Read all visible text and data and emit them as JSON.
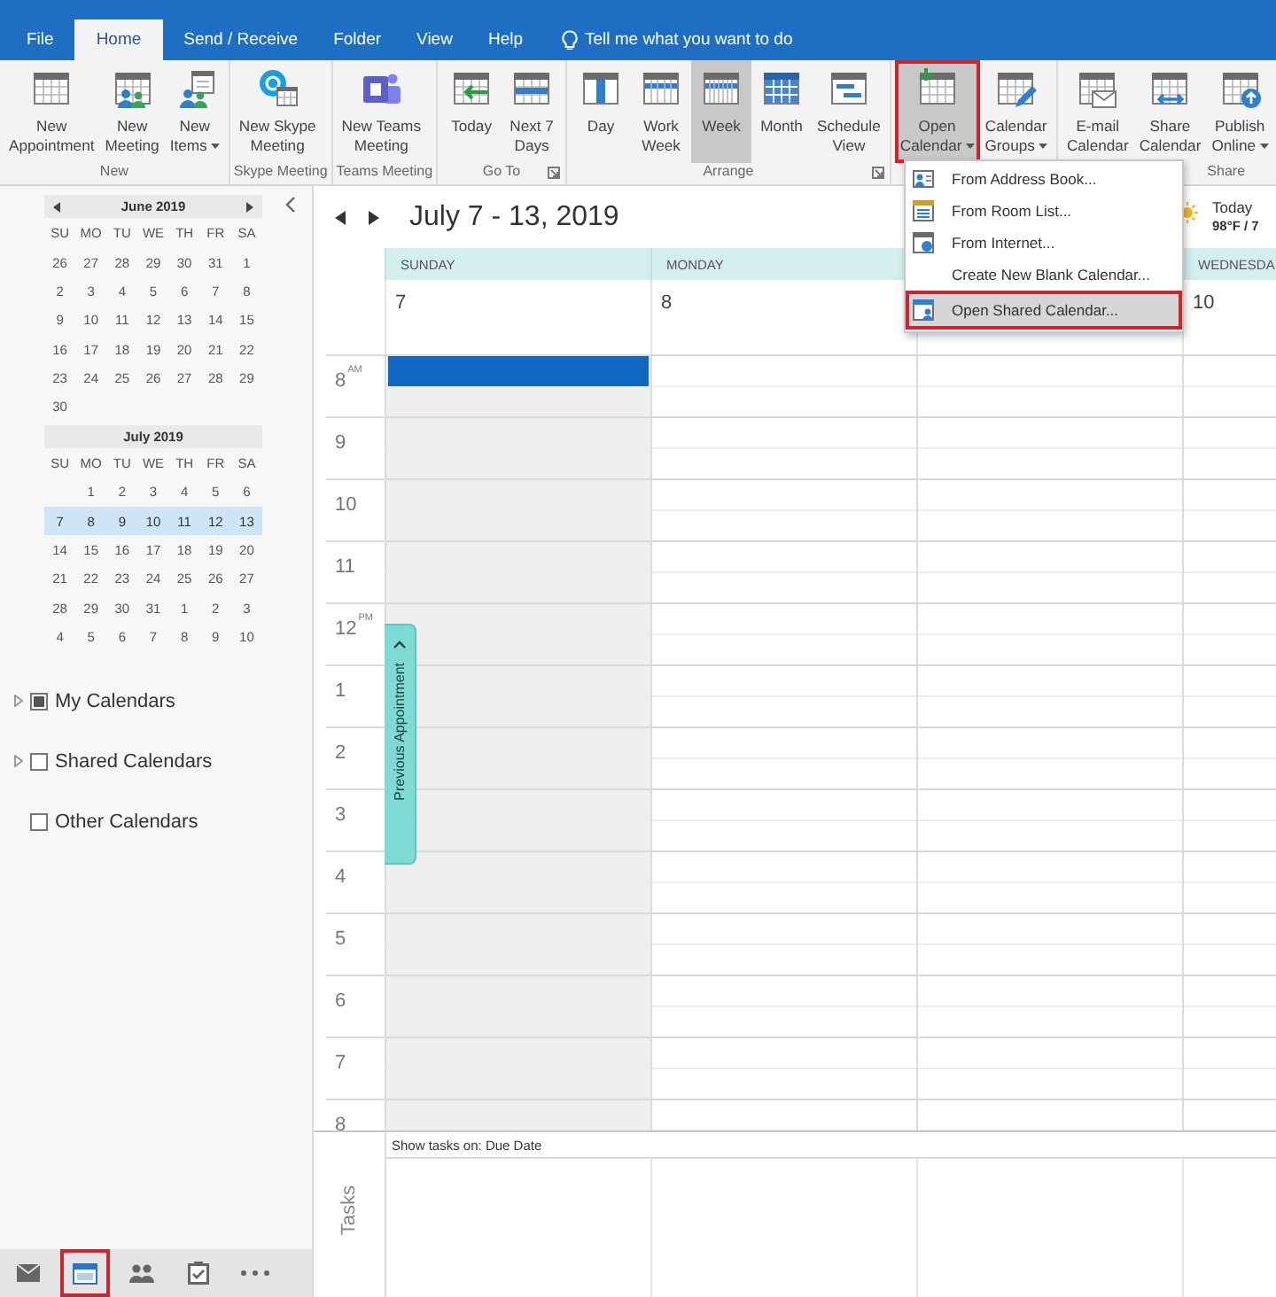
{
  "ribbon_tabs": [
    {
      "label": "File",
      "selected": false
    },
    {
      "label": "Home",
      "selected": true
    },
    {
      "label": "Send / Receive",
      "selected": false
    },
    {
      "label": "Folder",
      "selected": false
    },
    {
      "label": "View",
      "selected": false
    },
    {
      "label": "Help",
      "selected": false
    }
  ],
  "tell_me": {
    "placeholder": "Tell me what you want to do"
  },
  "ribbon_groups": [
    {
      "label": "New",
      "launcher": false,
      "buttons": [
        {
          "label": "New\nAppointment",
          "dropdown": false,
          "selected": false,
          "highlighted": false
        },
        {
          "label": "New\nMeeting",
          "dropdown": false,
          "selected": false,
          "highlighted": false
        },
        {
          "label": "New\nItems",
          "dropdown": true,
          "selected": false,
          "highlighted": false
        }
      ]
    },
    {
      "label": "Skype Meeting",
      "launcher": false,
      "buttons": [
        {
          "label": "New Skype\nMeeting",
          "dropdown": false,
          "selected": false,
          "highlighted": false
        }
      ]
    },
    {
      "label": "Teams Meeting",
      "launcher": false,
      "buttons": [
        {
          "label": "New Teams\nMeeting",
          "dropdown": false,
          "selected": false,
          "highlighted": false
        }
      ]
    },
    {
      "label": "Go To",
      "launcher": true,
      "buttons": [
        {
          "label": "Today",
          "dropdown": false,
          "selected": false,
          "highlighted": false
        },
        {
          "label": "Next 7\nDays",
          "dropdown": false,
          "selected": false,
          "highlighted": false
        }
      ]
    },
    {
      "label": "Arrange",
      "launcher": true,
      "buttons": [
        {
          "label": "Day",
          "dropdown": false,
          "selected": false,
          "highlighted": false
        },
        {
          "label": "Work\nWeek",
          "dropdown": false,
          "selected": false,
          "highlighted": false
        },
        {
          "label": "Week",
          "dropdown": false,
          "selected": true,
          "highlighted": false
        },
        {
          "label": "Month",
          "dropdown": false,
          "selected": false,
          "highlighted": false
        },
        {
          "label": "Schedule\nView",
          "dropdown": false,
          "selected": false,
          "highlighted": false
        }
      ]
    },
    {
      "buttons": [
        {
          "label": "Open\nCalendar",
          "dropdown": true,
          "selected": true,
          "highlighted": true
        },
        {
          "label": "Calendar\nGroups",
          "dropdown": true,
          "selected": false,
          "highlighted": false
        }
      ]
    },
    {
      "label": "Share",
      "launcher": false,
      "buttons": [
        {
          "label": "E-mail\nCalendar",
          "dropdown": false,
          "selected": false,
          "highlighted": false
        },
        {
          "label": "Share\nCalendar",
          "dropdown": false,
          "selected": false,
          "highlighted": false
        },
        {
          "label": "Publish\nOnline",
          "dropdown": true,
          "selected": false,
          "highlighted": false
        }
      ]
    }
  ],
  "open_calendar_menu": {
    "items": [
      {
        "label": "From Address Book...",
        "selected": false,
        "highlighted": false
      },
      {
        "label": "From Room List...",
        "selected": false,
        "highlighted": false
      },
      {
        "label": "From Internet...",
        "selected": false,
        "highlighted": false
      },
      {
        "label": "Create New Blank Calendar...",
        "selected": false,
        "highlighted": false
      },
      {
        "label": "Open Shared Calendar...",
        "selected": true,
        "highlighted": true
      }
    ]
  },
  "date_navigator": {
    "months": [
      {
        "title": "June 2019",
        "arrows": true,
        "weekdays": [
          "SU",
          "MO",
          "TU",
          "WE",
          "TH",
          "FR",
          "SA"
        ],
        "weeks": [
          {
            "days": [
              "26",
              "27",
              "28",
              "29",
              "30",
              "31",
              "1"
            ],
            "selected": false
          },
          {
            "days": [
              "2",
              "3",
              "4",
              "5",
              "6",
              "7",
              "8"
            ],
            "selected": false
          },
          {
            "days": [
              "9",
              "10",
              "11",
              "12",
              "13",
              "14",
              "15"
            ],
            "selected": false
          },
          {
            "days": [
              "16",
              "17",
              "18",
              "19",
              "20",
              "21",
              "22"
            ],
            "selected": false
          },
          {
            "days": [
              "23",
              "24",
              "25",
              "26",
              "27",
              "28",
              "29"
            ],
            "selected": false
          },
          {
            "days": [
              "30"
            ],
            "selected": false
          }
        ]
      },
      {
        "title": "July 2019",
        "arrows": false,
        "weekdays": [
          "SU",
          "MO",
          "TU",
          "WE",
          "TH",
          "FR",
          "SA"
        ],
        "weeks": [
          {
            "days": [
              "1",
              "2",
              "3",
              "4",
              "5",
              "6"
            ],
            "selected": false
          },
          {
            "days": [
              "7",
              "8",
              "9",
              "10",
              "11",
              "12",
              "13"
            ],
            "selected": true
          },
          {
            "days": [
              "14",
              "15",
              "16",
              "17",
              "18",
              "19",
              "20"
            ],
            "selected": false
          },
          {
            "days": [
              "21",
              "22",
              "23",
              "24",
              "25",
              "26",
              "27"
            ],
            "selected": false
          },
          {
            "days": [
              "28",
              "29",
              "30",
              "31",
              "1",
              "2",
              "3"
            ],
            "selected": false
          },
          {
            "days": [
              "4",
              "5",
              "6",
              "7",
              "8",
              "9",
              "10"
            ],
            "selected": false
          }
        ]
      }
    ]
  },
  "calendar_folders": [
    {
      "label": "My Calendars",
      "expandable": true,
      "checked": true
    },
    {
      "label": "Shared Calendars",
      "expandable": true,
      "checked": false
    },
    {
      "label": "Other Calendars",
      "expandable": false,
      "checked": false
    }
  ],
  "nav_bar": [
    {
      "selected": false,
      "highlighted": false
    },
    {
      "selected": true,
      "highlighted": true
    },
    {
      "selected": false,
      "highlighted": false
    },
    {
      "selected": false,
      "highlighted": false
    },
    {
      "selected": false,
      "highlighted": false
    }
  ],
  "calendar": {
    "title": "July 7 - 13, 2019",
    "weather": {
      "label": "Today",
      "reading": "98°F / 7"
    },
    "days": [
      {
        "weekday": "SUNDAY",
        "date": "7",
        "working_day": false,
        "selected": true
      },
      {
        "weekday": "MONDAY",
        "date": "8",
        "working_day": true,
        "selected": false
      },
      {
        "working_day": true,
        "selected": false
      },
      {
        "weekday": "WEDNESDA",
        "date": "10",
        "working_day": true,
        "selected": false
      }
    ],
    "hours": [
      "8$^{AM}$",
      "9",
      "10",
      "11",
      "12$^{PM}$",
      "1",
      "2",
      "3",
      "4",
      "5",
      "6",
      "7",
      "8"
    ],
    "previous_appointment": "Previous Appointment",
    "tasks": {
      "filter": "Show tasks on: Due Date",
      "label": "Tasks"
    }
  }
}
